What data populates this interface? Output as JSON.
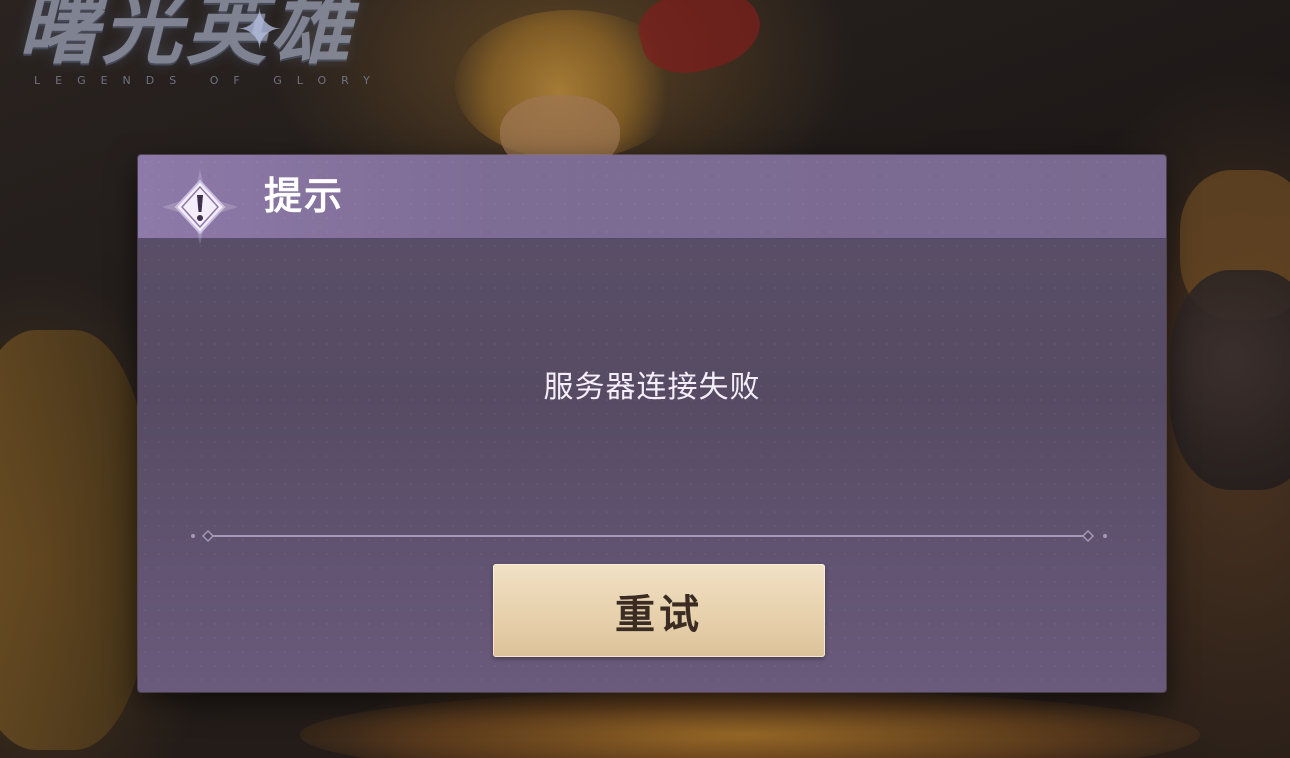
{
  "logo": {
    "title": "曙光英雄",
    "subtitle": "LEGENDS OF GLORY"
  },
  "dialog": {
    "title": "提示",
    "message": "服务器连接失败",
    "retry_label": "重试",
    "header_icon": "warning-diamond-icon"
  },
  "colors": {
    "dialog_background": "#5b5069",
    "header_background": "#8e7aa9",
    "button_background": "#e7d1ac",
    "button_text": "#3a2b23",
    "text": "#ffffff"
  }
}
